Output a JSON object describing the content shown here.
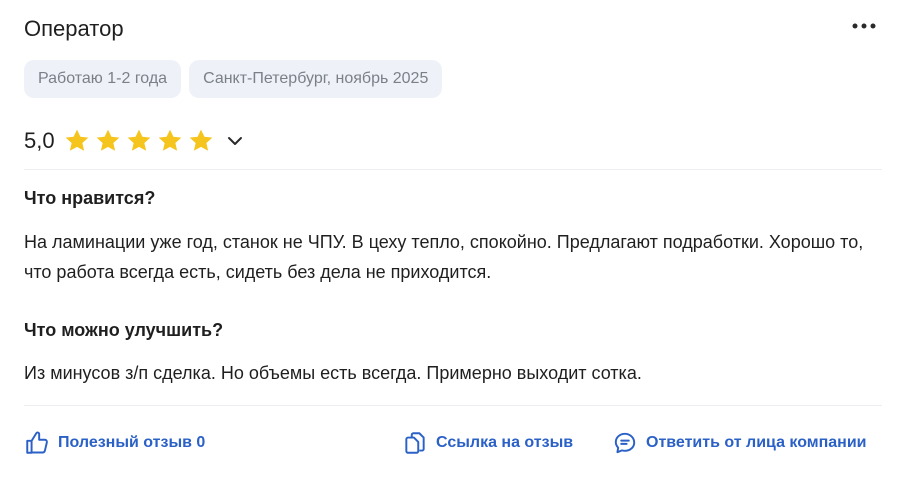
{
  "review": {
    "title": "Оператор",
    "tags": [
      "Работаю 1-2 года",
      "Санкт-Петербург, ноябрь 2025"
    ],
    "rating": {
      "value": "5,0",
      "stars": 5,
      "max": 5
    },
    "likes_title": "Что нравится?",
    "likes_text": "На ламинации уже год, станок не ЧПУ. В цеху тепло, спокойно. Предлагают подработки. Хорошо то, что работа всегда есть, сидеть без дела не приходится.",
    "improve_title": "Что можно улучшить?",
    "improve_text": "Из минусов з/п сделка. Но объемы есть всегда. Примерно выходит сотка."
  },
  "actions": {
    "helpful_label": "Полезный отзыв 0",
    "link_label": "Ссылка на отзыв",
    "reply_label": "Ответить от лица компании"
  },
  "colors": {
    "accent": "#2b61c7",
    "star": "#f5c41d",
    "tag_bg": "#eef1f7",
    "tag_text": "#7b7f88"
  },
  "icons": [
    "more-horizontal-icon",
    "star-icon",
    "chevron-down-icon",
    "thumbs-up-icon",
    "copy-link-icon",
    "chat-reply-icon"
  ]
}
